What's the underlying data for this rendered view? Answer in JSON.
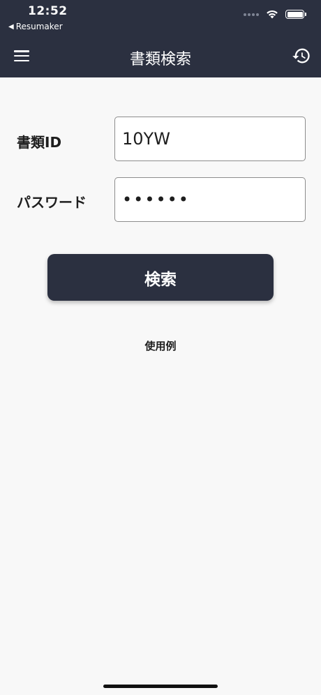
{
  "status_bar": {
    "time": "12:52",
    "back_app": "Resumaker"
  },
  "nav": {
    "title": "書類検索"
  },
  "form": {
    "doc_id_label": "書類ID",
    "doc_id_value": "10YW",
    "password_label": "パスワード",
    "password_value": "••••••"
  },
  "search_button": {
    "label": "検索"
  },
  "usage_link": {
    "label": "使用例"
  },
  "colors": {
    "header_bg": "#2b3040",
    "page_bg": "#f8f8f8",
    "button_bg": "#2b3040",
    "text_dark": "#1e1e1e"
  },
  "icons": {
    "menu": "hamburger-menu-icon",
    "history": "history-icon",
    "wifi": "wifi-icon",
    "battery": "battery-icon",
    "signal": "cellular-signal-icon",
    "back": "back-triangle-icon"
  }
}
